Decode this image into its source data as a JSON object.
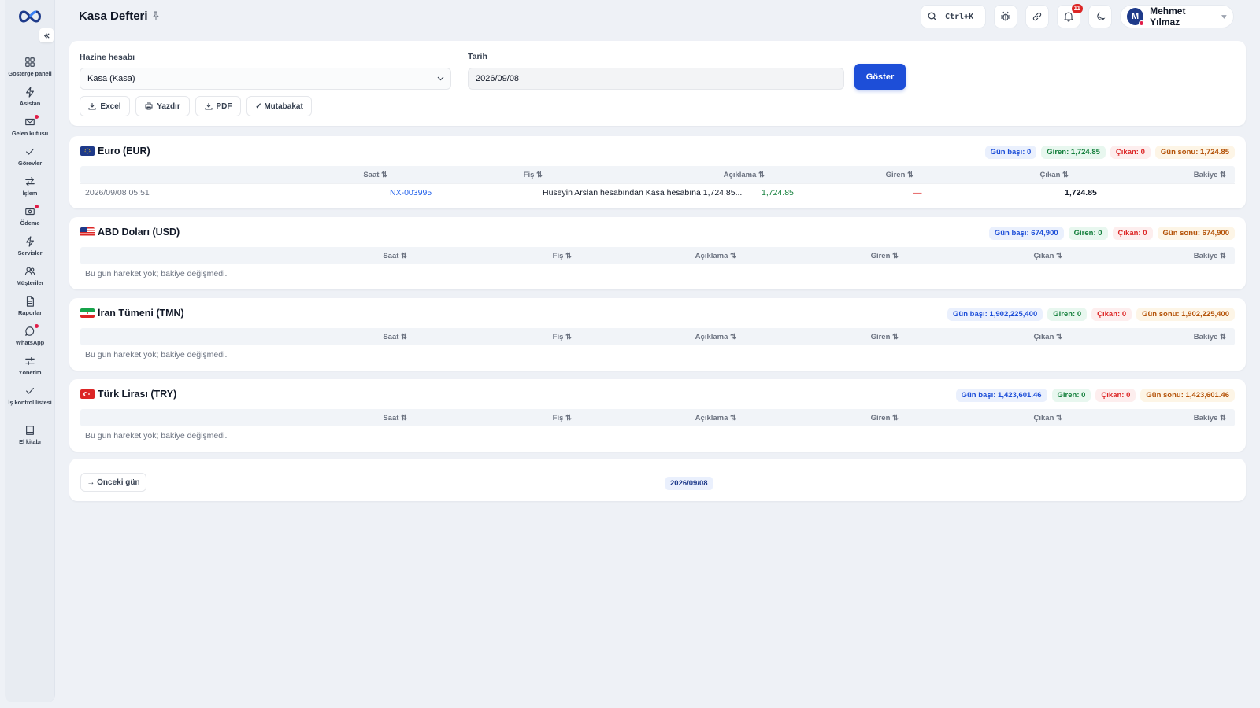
{
  "page_title": "Kasa Defteri",
  "sidebar": {
    "items": [
      {
        "label": "Gösterge paneli",
        "icon": "dashboard-icon",
        "dot": false
      },
      {
        "label": "Asistan",
        "icon": "bolt-icon",
        "dot": false
      },
      {
        "label": "Gelen kutusu",
        "icon": "inbox-icon",
        "dot": true
      },
      {
        "label": "Görevler",
        "icon": "check-icon",
        "dot": false
      },
      {
        "label": "İşlem",
        "icon": "transfer-icon",
        "dot": false
      },
      {
        "label": "Ödeme",
        "icon": "payment-icon",
        "dot": true
      },
      {
        "label": "Servisler",
        "icon": "bolt-icon",
        "dot": false
      },
      {
        "label": "Müşteriler",
        "icon": "users-icon",
        "dot": false
      },
      {
        "label": "Raporlar",
        "icon": "report-icon",
        "dot": false
      },
      {
        "label": "WhatsApp",
        "icon": "chat-icon",
        "dot": true
      },
      {
        "label": "Yönetim",
        "icon": "sliders-icon",
        "dot": false
      },
      {
        "label": "İş kontrol listesi",
        "icon": "check-icon",
        "dot": false
      },
      {
        "label": "El kitabı",
        "icon": "book-icon",
        "dot": false
      }
    ]
  },
  "topbar": {
    "search_shortcut": "Ctrl+K",
    "notification_count": "11",
    "user_initial": "M",
    "user_name": "Mehmet Yılmaz"
  },
  "filters": {
    "account_label": "Hazine hesabı",
    "account_value": "Kasa (Kasa)",
    "date_label": "Tarih",
    "date_value": "2026/09/08",
    "show_button": "Göster",
    "actions": {
      "excel": "Excel",
      "print": "Yazdır",
      "pdf": "PDF",
      "reconcile": "✓ Mutabakat"
    }
  },
  "columns": [
    "Saat ⇅",
    "Fiş ⇅",
    "Açıklama ⇅",
    "Giren ⇅",
    "Çıkan ⇅",
    "Bakiye ⇅"
  ],
  "empty_message": "Bu gün hareket yok; bakiye değişmedi.",
  "currencies": [
    {
      "title": "Euro (EUR)",
      "flag": "eu",
      "opening": "Gün başı: 0",
      "incoming": "Giren: 1,724.85",
      "outgoing": "Çıkan: 0",
      "closing": "Gün sonu: 1,724.85",
      "rows": [
        {
          "time": "2026/09/08 05:51",
          "voucher": "NX-003995",
          "description": "Hüseyin Arslan hesabından Kasa hesabına 1,724.85...",
          "in": "1,724.85",
          "out": "—",
          "balance": "1,724.85"
        }
      ]
    },
    {
      "title": "ABD Doları (USD)",
      "flag": "us",
      "opening": "Gün başı: 674,900",
      "incoming": "Giren: 0",
      "outgoing": "Çıkan: 0",
      "closing": "Gün sonu: 674,900",
      "rows": []
    },
    {
      "title": "İran Tümeni (TMN)",
      "flag": "ir",
      "opening": "Gün başı: 1,902,225,400",
      "incoming": "Giren: 0",
      "outgoing": "Çıkan: 0",
      "closing": "Gün sonu: 1,902,225,400",
      "rows": []
    },
    {
      "title": "Türk Lirası (TRY)",
      "flag": "tr",
      "opening": "Gün başı: 1,423,601.46",
      "incoming": "Giren: 0",
      "outgoing": "Çıkan: 0",
      "closing": "Gün sonu: 1,423,601.46",
      "rows": []
    }
  ],
  "footer_nav": {
    "prev_label": "→ Önceki gün",
    "current_date": "2026/09/08"
  },
  "colors": {
    "primary": "#1d4ed8",
    "income": "#15803d",
    "expense": "#dc2626",
    "warning": "#b45309",
    "link": "#2563eb"
  }
}
